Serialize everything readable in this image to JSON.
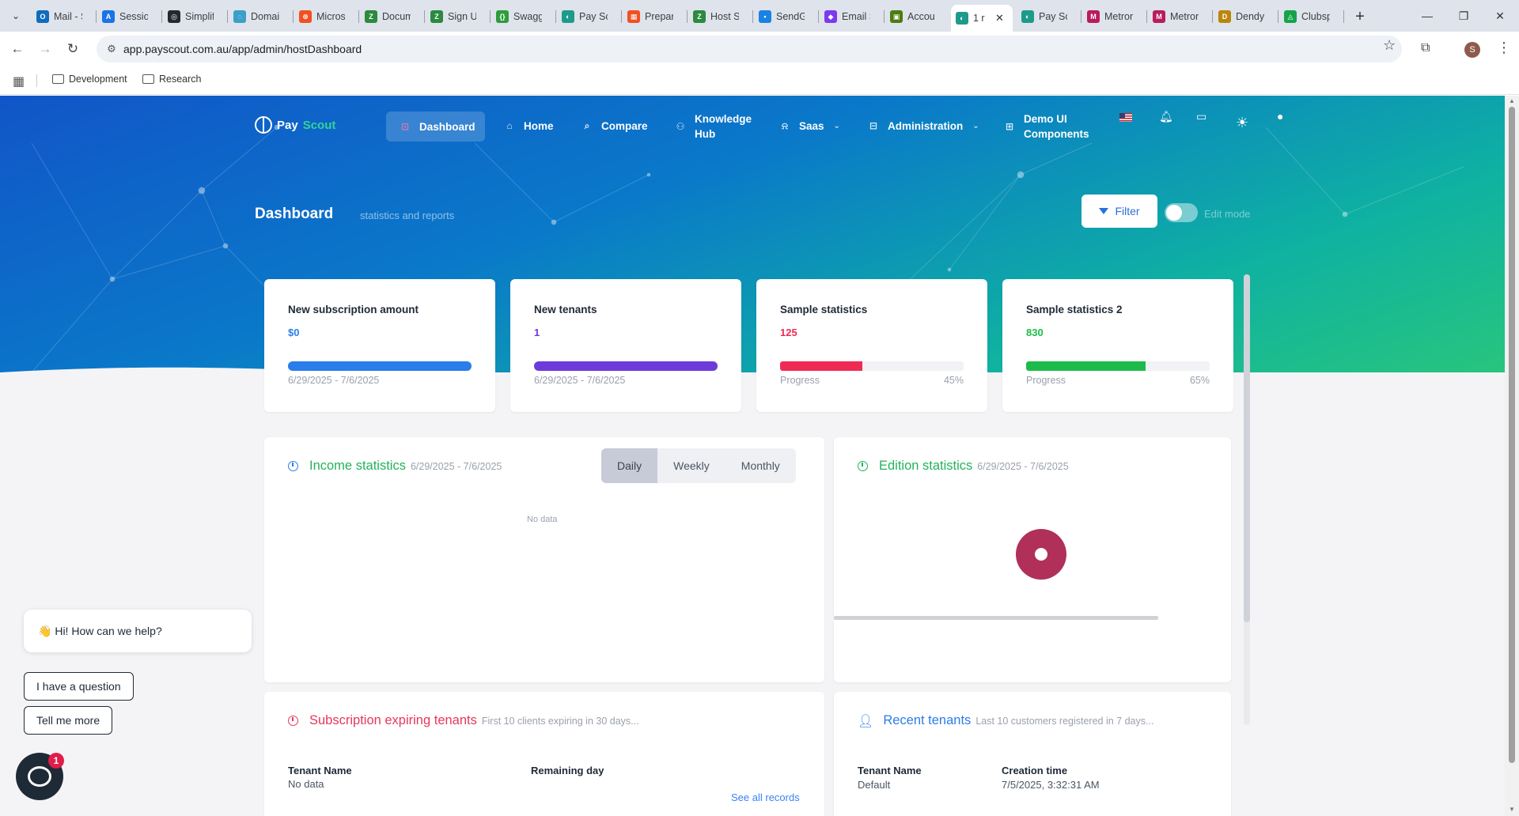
{
  "browser": {
    "tabs": [
      {
        "title": "Mail - S",
        "color": "#0f6cbd",
        "glyph": "O"
      },
      {
        "title": "Session",
        "color": "#1a73e8",
        "glyph": "A"
      },
      {
        "title": "Simplif",
        "color": "#24292f",
        "glyph": "◎"
      },
      {
        "title": "Domai",
        "color": "#3aa0c7",
        "glyph": "◌"
      },
      {
        "title": "Micros",
        "color": "#f25022",
        "glyph": "⊕"
      },
      {
        "title": "Docum",
        "color": "#2b8a3e",
        "glyph": "Z"
      },
      {
        "title": "Sign U",
        "color": "#2b8a3e",
        "glyph": "Z"
      },
      {
        "title": "Swagg",
        "color": "#2e9c3a",
        "glyph": "{}"
      },
      {
        "title": "Pay Sc",
        "color": "#1d9b8a",
        "glyph": "◐"
      },
      {
        "title": "Prepar",
        "color": "#f25022",
        "glyph": "▦"
      },
      {
        "title": "Host S",
        "color": "#2b8a3e",
        "glyph": "Z"
      },
      {
        "title": "SendG",
        "color": "#1a82e2",
        "glyph": "▪"
      },
      {
        "title": "Email S",
        "color": "#7c3aed",
        "glyph": "◆"
      },
      {
        "title": "Accou",
        "color": "#4d7c0f",
        "glyph": "▣"
      },
      {
        "title": "1 r",
        "color": "#1d9b8a",
        "glyph": "◐",
        "active": true
      },
      {
        "title": "Pay Sc",
        "color": "#1d9b8a",
        "glyph": "◐"
      },
      {
        "title": "Metror",
        "color": "#b91c5c",
        "glyph": "M"
      },
      {
        "title": "Metror",
        "color": "#b91c5c",
        "glyph": "M"
      },
      {
        "title": "Dendy",
        "color": "#b8860b",
        "glyph": "D"
      },
      {
        "title": "Clubsp",
        "color": "#16a34a",
        "glyph": "◬"
      }
    ],
    "url": "app.payscout.com.au/app/admin/hostDashboard",
    "profile_initial": "S",
    "bookmarks": [
      "Development",
      "Research"
    ]
  },
  "header": {
    "logo_pay": "Pay",
    "logo_scout": "Scout",
    "menu": {
      "dashboard": "Dashboard",
      "home": "Home",
      "compare": "Compare",
      "knowledge_1": "Knowledge",
      "knowledge_2": "Hub",
      "saas": "Saas",
      "administration": "Administration",
      "demo_1": "Demo UI",
      "demo_2": "Components"
    }
  },
  "page": {
    "title": "Dashboard",
    "subtitle": "statistics and reports",
    "filter_label": "Filter",
    "edit_mode_label": "Edit mode"
  },
  "stats": [
    {
      "title": "New subscription amount",
      "value": "$0",
      "color": "#2b7de9",
      "fill": 1.0,
      "foot": "6/29/2025 - 7/6/2025",
      "pct": ""
    },
    {
      "title": "New tenants",
      "value": "1",
      "color": "#6d3bd9",
      "fill": 1.0,
      "foot": "6/29/2025 - 7/6/2025",
      "pct": ""
    },
    {
      "title": "Sample statistics",
      "value": "125",
      "color": "#ef2b55",
      "fill": 0.45,
      "foot": "Progress",
      "pct": "45%"
    },
    {
      "title": "Sample statistics 2",
      "value": "830",
      "color": "#1dbb4a",
      "fill": 0.65,
      "foot": "Progress",
      "pct": "65%"
    }
  ],
  "income": {
    "title": "Income statistics",
    "range": "6/29/2025 - 7/6/2025",
    "tabs": [
      "Daily",
      "Weekly",
      "Monthly"
    ],
    "active_tab": "Daily",
    "empty": "No data"
  },
  "edition": {
    "title": "Edition statistics",
    "range": "6/29/2025 - 7/6/2025"
  },
  "expiring": {
    "title": "Subscription expiring tenants",
    "subtitle": "First 10 clients expiring in 30 days...",
    "col1": "Tenant Name",
    "col2": "Remaining day",
    "empty": "No data",
    "see_all": "See all records"
  },
  "recent": {
    "title": "Recent tenants",
    "subtitle": "Last 10 customers registered in 7 days...",
    "col1": "Tenant Name",
    "col2": "Creation time",
    "rows": [
      {
        "name": "Default",
        "created": "7/5/2025, 3:32:31 AM"
      }
    ]
  },
  "chat": {
    "greeting_emoji": "👋",
    "greeting": "Hi! How can we help?",
    "btn_question": "I have a question",
    "btn_more": "Tell me more",
    "badge": "1"
  },
  "colors": {
    "income_green": "#22b35a",
    "expiring_red": "#e8365d",
    "recent_blue": "#2b7de9"
  }
}
